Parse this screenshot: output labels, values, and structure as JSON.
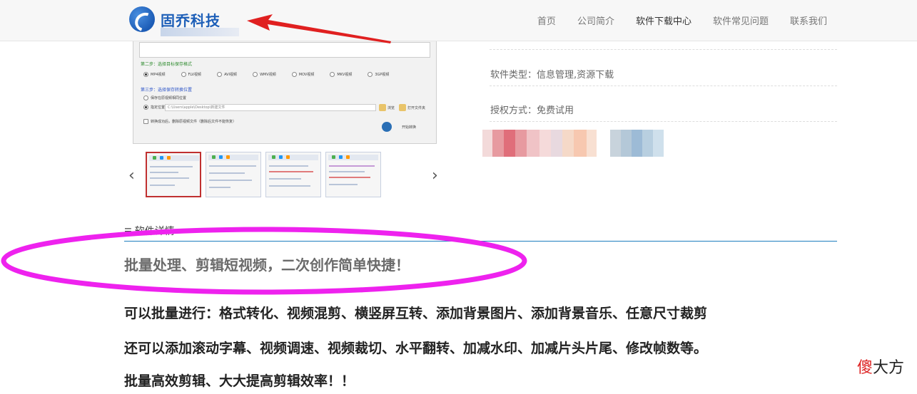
{
  "header": {
    "logo_text": "固乔科技",
    "nav": [
      {
        "label": "首页",
        "active": false
      },
      {
        "label": "公司简介",
        "active": false
      },
      {
        "label": "软件下载中心",
        "active": true
      },
      {
        "label": "软件常见问题",
        "active": false
      },
      {
        "label": "联系我们",
        "active": false
      }
    ]
  },
  "screenshot_panel": {
    "step2_label": "第二步：选择目标保存格式",
    "step3_label": "第三步：选择保存转换位置",
    "format_options": [
      "MP4视频",
      "FLV视频",
      "AVI视频",
      "WMV视频",
      "MOV视频",
      "MKV视频",
      "3GP视频"
    ],
    "save_option_1": "保存在原视频相同位置",
    "save_option_2": "指定位置",
    "path_value": "C:\\Users\\apple\\Desktop\\新建文件",
    "browse_label": "浏览",
    "open_folder_label": "打开文件夹",
    "delete_option": "转换成功后，删除原视频文件（删除后文件不能恢复）",
    "start_label": "开始转换"
  },
  "carousel": {
    "prev_icon": "chevron-left-icon",
    "next_icon": "chevron-right-icon",
    "thumbnail_count": 4
  },
  "info": {
    "software_type": "软件类型：信息管理,资源下载",
    "license": "授权方式：免费试用"
  },
  "details": {
    "section_title": "软件详情",
    "headline": "批量处理、剪辑短视频，二次创作简单快捷！",
    "paragraphs": [
      "可以批量进行：格式转化、视频混剪、横竖屏互转、添加背景图片、添加背景音乐、任意尺寸裁剪",
      "还可以添加滚动字幕、视频调速、视频裁切、水平翻转、加减水印、加减片头片尾、修改帧数等。",
      "批量高效剪辑、大大提高剪辑效率！！"
    ]
  },
  "watermark": {
    "red_part": "傻",
    "rest": "大方"
  },
  "colors": {
    "accent_blue": "#1e7fbf",
    "annotation_red": "#e02020",
    "annotation_magenta": "#ee22ee",
    "logo_blue": "#1d5fb8"
  }
}
